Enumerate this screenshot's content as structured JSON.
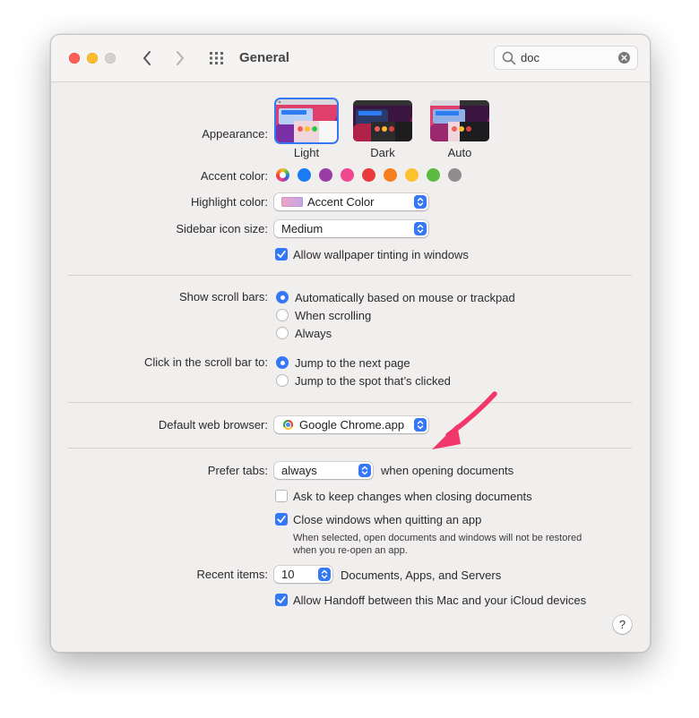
{
  "window": {
    "title": "General"
  },
  "search": {
    "value": "doc"
  },
  "appearance": {
    "label": "Appearance:",
    "options": [
      {
        "name": "Light",
        "selected": true
      },
      {
        "name": "Dark",
        "selected": false
      },
      {
        "name": "Auto",
        "selected": false
      }
    ]
  },
  "accent": {
    "label": "Accent color:",
    "colors": [
      "multicolor",
      "#1a7cf5",
      "#9a3da6",
      "#f0478f",
      "#e8393b",
      "#f6801f",
      "#fbc12e",
      "#5dbb44",
      "#8e8c8c"
    ],
    "selected": "multicolor"
  },
  "highlight": {
    "label": "Highlight color:",
    "value": "Accent Color"
  },
  "sidebar_icon": {
    "label": "Sidebar icon size:",
    "value": "Medium"
  },
  "wallpaper_tinting": {
    "label": "Allow wallpaper tinting in windows",
    "checked": true
  },
  "scroll_bars": {
    "label": "Show scroll bars:",
    "options": [
      "Automatically based on mouse or trackpad",
      "When scrolling",
      "Always"
    ],
    "selected": 0
  },
  "click_scroll": {
    "label": "Click in the scroll bar to:",
    "options": [
      "Jump to the next page",
      "Jump to the spot that’s clicked"
    ],
    "selected": 0
  },
  "browser": {
    "label": "Default web browser:",
    "value": "Google Chrome.app"
  },
  "prefer_tabs": {
    "label": "Prefer tabs:",
    "value": "always",
    "suffix": "when opening documents"
  },
  "ask_keep": {
    "label": "Ask to keep changes when closing documents",
    "checked": false
  },
  "close_windows": {
    "label": "Close windows when quitting an app",
    "checked": true,
    "note_line1": "When selected, open documents and windows will not be restored",
    "note_line2": "when you re-open an app."
  },
  "recent": {
    "label": "Recent items:",
    "value": "10",
    "suffix": "Documents, Apps, and Servers"
  },
  "handoff": {
    "label": "Allow Handoff between this Mac and your iCloud devices",
    "checked": true
  },
  "help": {
    "label": "?"
  },
  "colors": {
    "accent_blue": "#3478f6",
    "annotation_arrow": "#f2376b"
  }
}
